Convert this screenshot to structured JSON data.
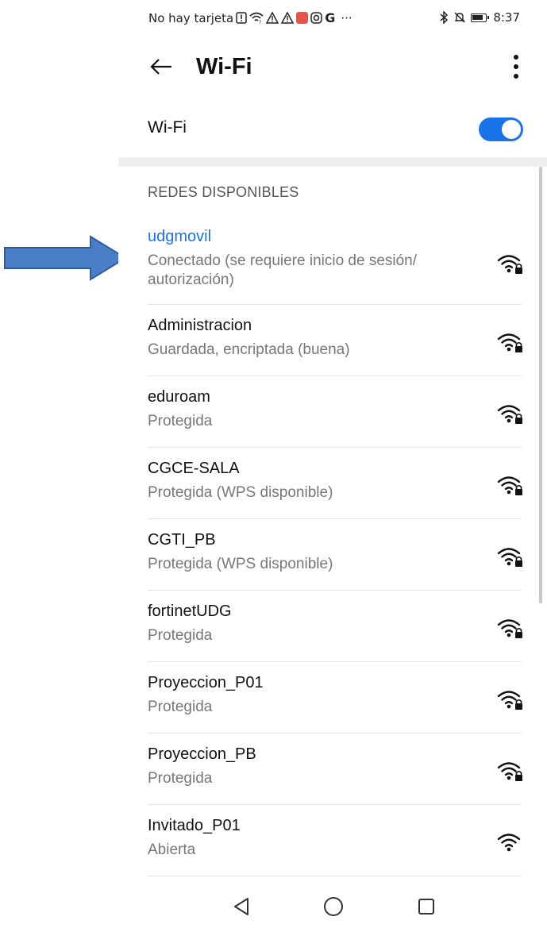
{
  "status_bar": {
    "carrier_text": "No hay tarjeta",
    "overflow": "···",
    "time": "8:37"
  },
  "header": {
    "title": "Wi-Fi",
    "back_icon": "arrow-left-icon",
    "more_icon": "more-vert-icon"
  },
  "wifi_toggle": {
    "label": "Wi-Fi",
    "state": "on",
    "accent_color": "#1a73e8"
  },
  "section": {
    "header": "REDES DISPONIBLES"
  },
  "networks": [
    {
      "name": "udgmovil",
      "status": "Conectado  (se requiere inicio de sesión/",
      "status2": "autorización)",
      "secured": true,
      "connected": true
    },
    {
      "name": "Administracion",
      "status": "Guardada, encriptada  (buena)",
      "secured": true,
      "connected": false
    },
    {
      "name": "eduroam",
      "status": "Protegida",
      "secured": true,
      "connected": false
    },
    {
      "name": "CGCE-SALA",
      "status": "Protegida (WPS disponible)",
      "secured": true,
      "connected": false
    },
    {
      "name": "CGTI_PB",
      "status": "Protegida (WPS disponible)",
      "secured": true,
      "connected": false
    },
    {
      "name": "fortinetUDG",
      "status": "Protegida",
      "secured": true,
      "connected": false
    },
    {
      "name": "Proyeccion_P01",
      "status": "Protegida",
      "secured": true,
      "connected": false
    },
    {
      "name": "Proyeccion_PB",
      "status": "Protegida",
      "secured": true,
      "connected": false
    },
    {
      "name": "Invitado_P01",
      "status": "Abierta",
      "secured": false,
      "connected": false
    }
  ],
  "nav": {
    "back_icon": "nav-back-triangle-icon",
    "home_icon": "nav-home-circle-icon",
    "recents_icon": "nav-recents-square-icon"
  },
  "annotation": {
    "arrow_color": "#4a7ec9"
  }
}
